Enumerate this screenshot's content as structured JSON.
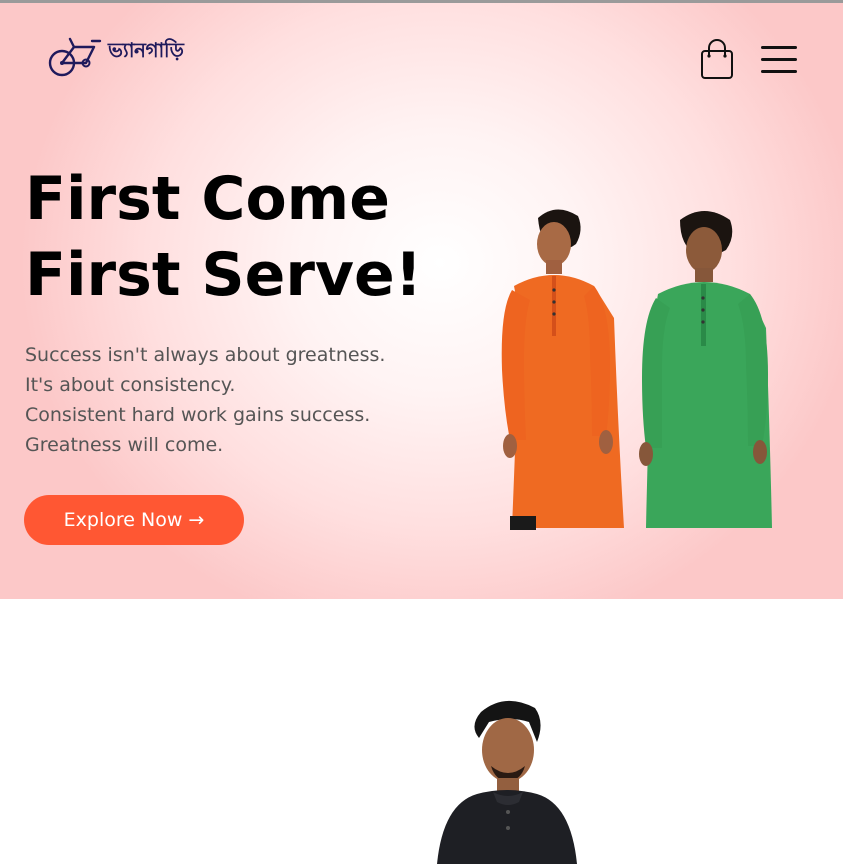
{
  "header": {
    "logo_text": "ভ্যানগাড়ি",
    "logo_icon": "bicycle-icon",
    "cart_icon": "shopping-bag-icon",
    "menu_icon": "hamburger-menu-icon"
  },
  "hero": {
    "headline": [
      "First Come",
      "First Serve!"
    ],
    "copy": [
      "Success isn't always about greatness.",
      "It's about consistency.",
      "Consistent hard work gains success.",
      "Greatness will come."
    ],
    "cta_label": "Explore Now",
    "cta_arrow": "→"
  },
  "colors": {
    "accent": "#ff5733",
    "hero_bg": "#ffdede",
    "logo_color": "#1f1a5c",
    "kurta_orange": "#ef6a22",
    "kurta_green": "#3aa65a"
  }
}
